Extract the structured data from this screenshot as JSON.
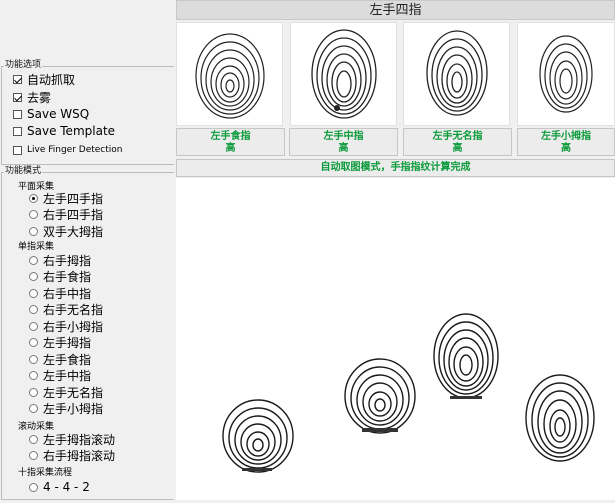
{
  "options_group": {
    "label": "功能选项",
    "auto_capture": {
      "label": "自动抓取",
      "checked": true
    },
    "remove_fog": {
      "label": "去雾",
      "checked": true
    },
    "save_wsq": {
      "label": "Save WSQ",
      "checked": false
    },
    "save_template": {
      "label": "Save Template",
      "checked": false
    },
    "live_finger": {
      "label": "Live Finger Detection",
      "checked": false
    }
  },
  "mode_group": {
    "label": "功能模式",
    "flat_section": "平面采集",
    "flat_items": [
      "左手四手指",
      "右手四手指",
      "双手大拇指"
    ],
    "flat_selected": 0,
    "single_section": "单指采集",
    "single_items": [
      "右手拇指",
      "右手食指",
      "右手中指",
      "右手无名指",
      "右手小拇指",
      "左手拇指",
      "左手食指",
      "左手中指",
      "左手无名指",
      "左手小拇指"
    ],
    "roll_section": "滚动采集",
    "roll_items": [
      "左手拇指滚动",
      "右手拇指滚动"
    ],
    "ten_section": "十指采集流程",
    "ten_items": [
      "4 - 4 - 2"
    ]
  },
  "main": {
    "title": "左手四指",
    "tiles": [
      {
        "caption": "左手食指\n高"
      },
      {
        "caption": "左手中指\n高"
      },
      {
        "caption": "左手无名指\n高"
      },
      {
        "caption": "左手小拇指\n高"
      }
    ],
    "status": "自动取图模式，手指指纹计算完成"
  },
  "colors": {
    "caption_green": "#0a9a3a",
    "panel_bg": "#f0f0f0"
  }
}
